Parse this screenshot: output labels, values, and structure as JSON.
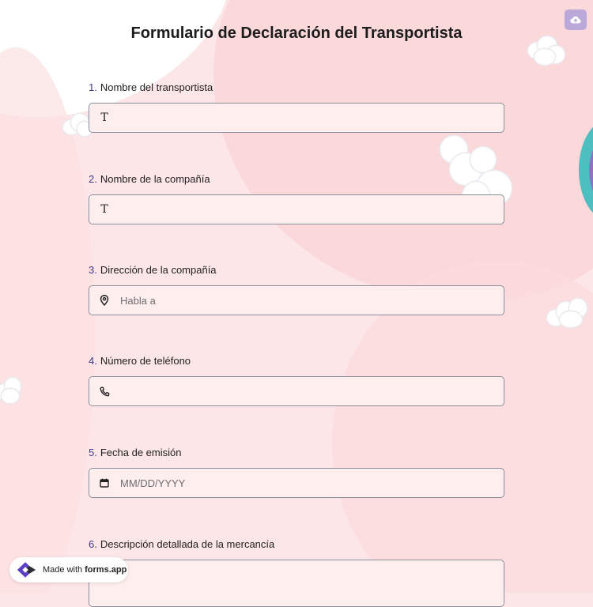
{
  "form": {
    "title": "Formulario de Declaración del Transportista",
    "questions": [
      {
        "number": "1.",
        "label": "Nombre del transportista",
        "icon": "text-icon",
        "placeholder": "",
        "value": ""
      },
      {
        "number": "2.",
        "label": "Nombre de la compañía",
        "icon": "text-icon",
        "placeholder": "",
        "value": ""
      },
      {
        "number": "3.",
        "label": "Dirección de la compañía",
        "icon": "location-pin-icon",
        "placeholder": "Habla a",
        "value": ""
      },
      {
        "number": "4.",
        "label": "Número de teléfono",
        "icon": "phone-icon",
        "placeholder": "",
        "value": ""
      },
      {
        "number": "5.",
        "label": "Fecha de emisión",
        "icon": "calendar-icon",
        "placeholder": "MM/DD/YYYY",
        "value": ""
      },
      {
        "number": "6.",
        "label": "Descripción detallada de la mercancía",
        "icon": "",
        "placeholder": "",
        "value": ""
      }
    ],
    "text_icon_glyph": "T"
  },
  "toolbar": {
    "upload_icon": "cloud-upload-icon"
  },
  "badge": {
    "made_with": "Made with",
    "brand": "forms.app",
    "logo_icon": "forms-app-logo-icon"
  },
  "colors": {
    "background": "#fde6e7",
    "field_background": "#feeeee",
    "field_border": "#8a8f9c",
    "number_color": "#3d3a8a",
    "upload_button": "#b9a8d8",
    "accent_teal": "#4dbfc0",
    "accent_violet": "#8e73c5"
  }
}
